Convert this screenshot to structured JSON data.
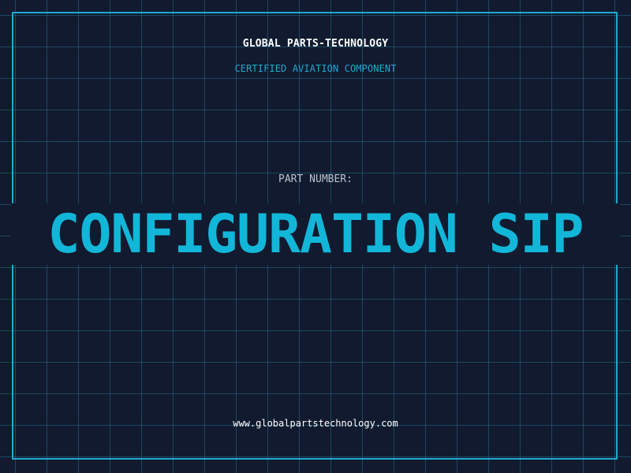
{
  "header": {
    "company_name": "GLOBAL PARTS-TECHNOLOGY",
    "subtitle": "CERTIFIED AVIATION COMPONENT"
  },
  "part": {
    "label": "PART NUMBER:",
    "number": "CONFIGURATION SIP"
  },
  "footer": {
    "website": "www.globalpartstechnology.com"
  },
  "colors": {
    "background": "#111a2e",
    "grid": "#246e8c",
    "accent": "#1fa9d0",
    "part_number": "#12b6d8",
    "label": "#b8c4d0",
    "text": "#ffffff"
  }
}
